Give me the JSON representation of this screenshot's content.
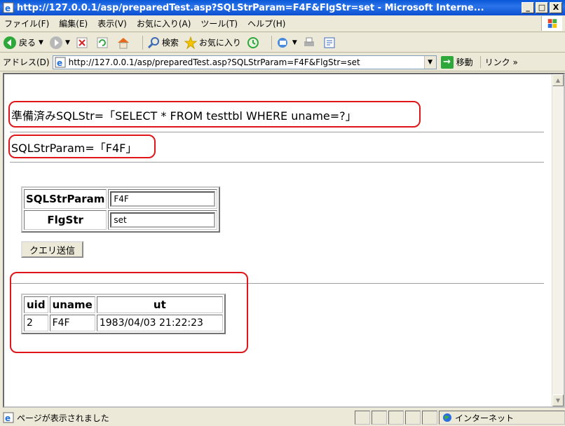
{
  "window": {
    "title": "http://127.0.0.1/asp/preparedTest.asp?SQLStrParam=F4F&FlgStr=set - Microsoft Interne...",
    "minimize": "_",
    "maximize": "□",
    "close": "X"
  },
  "menubar": {
    "items": [
      "ファイル(F)",
      "編集(E)",
      "表示(V)",
      "お気に入り(A)",
      "ツール(T)",
      "ヘルプ(H)"
    ]
  },
  "toolbar": {
    "back": "戻る",
    "search": "検索",
    "favorites": "お気に入り"
  },
  "address": {
    "label": "アドレス(D)",
    "url": "http://127.0.0.1/asp/preparedTest.asp?SQLStrParam=F4F&FlgStr=set",
    "go": "移動",
    "links": "リンク »"
  },
  "page": {
    "prepared_sql": "準備済みSQLStr=「SELECT * FROM testtbl WHERE uname=?」",
    "param_line": "SQLStrParam=「F4F」",
    "form": {
      "fields": [
        {
          "label": "SQLStrParam",
          "value": "F4F"
        },
        {
          "label": "FlgStr",
          "value": "set"
        }
      ],
      "submit": "クエリ送信"
    },
    "results": {
      "headers": [
        "uid",
        "uname",
        "ut"
      ],
      "rows": [
        [
          "2",
          "F4F",
          "1983/04/03 21:22:23"
        ]
      ]
    }
  },
  "status": {
    "text": "ページが表示されました",
    "zone": "インターネット"
  },
  "colors": {
    "highlight": "#e0161a",
    "titlebar": "#0a58d8"
  }
}
